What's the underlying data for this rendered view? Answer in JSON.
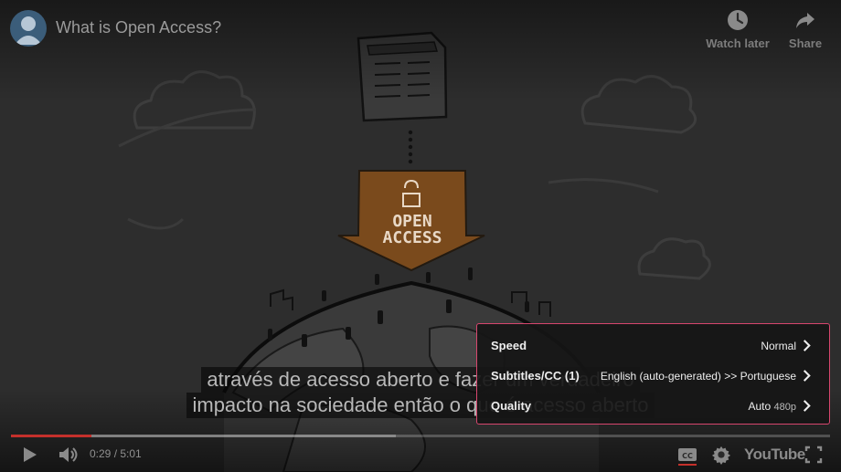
{
  "video": {
    "title": "What is Open Access?",
    "channel_avatar_icon": "channel-avatar-icon",
    "progress": {
      "watched_fraction": 0.0978,
      "loaded_fraction": 0.47
    }
  },
  "top_actions": {
    "watch_later": "Watch later",
    "share": "Share"
  },
  "illustration_text": {
    "arrow_label_line1": "OPEN",
    "arrow_label_line2": "ACCESS",
    "arrow_color": "#c06b18"
  },
  "captions": {
    "line1": "através de acesso aberto e fazer um verdadeiro",
    "line2": "impacto na sociedade então o que é acesso aberto"
  },
  "settings_menu": {
    "accent_border": "#d7466e",
    "items": [
      {
        "label": "Speed",
        "value": "Normal",
        "sub": ""
      },
      {
        "label": "Subtitles/CC (1)",
        "value": "English (auto-generated) >> Portuguese",
        "sub": ""
      },
      {
        "label": "Quality",
        "value": "Auto",
        "sub": "480p"
      }
    ]
  },
  "controls": {
    "current_time": "0:29",
    "separator": " / ",
    "duration": "5:01",
    "time_text": "0:29 / 5:01",
    "brand": "YouTube",
    "icons": [
      "play-icon",
      "volume-icon",
      "subtitles-icon",
      "settings-gear-icon",
      "youtube-logo",
      "fullscreen-icon"
    ],
    "progress_color": "#c4302b"
  }
}
